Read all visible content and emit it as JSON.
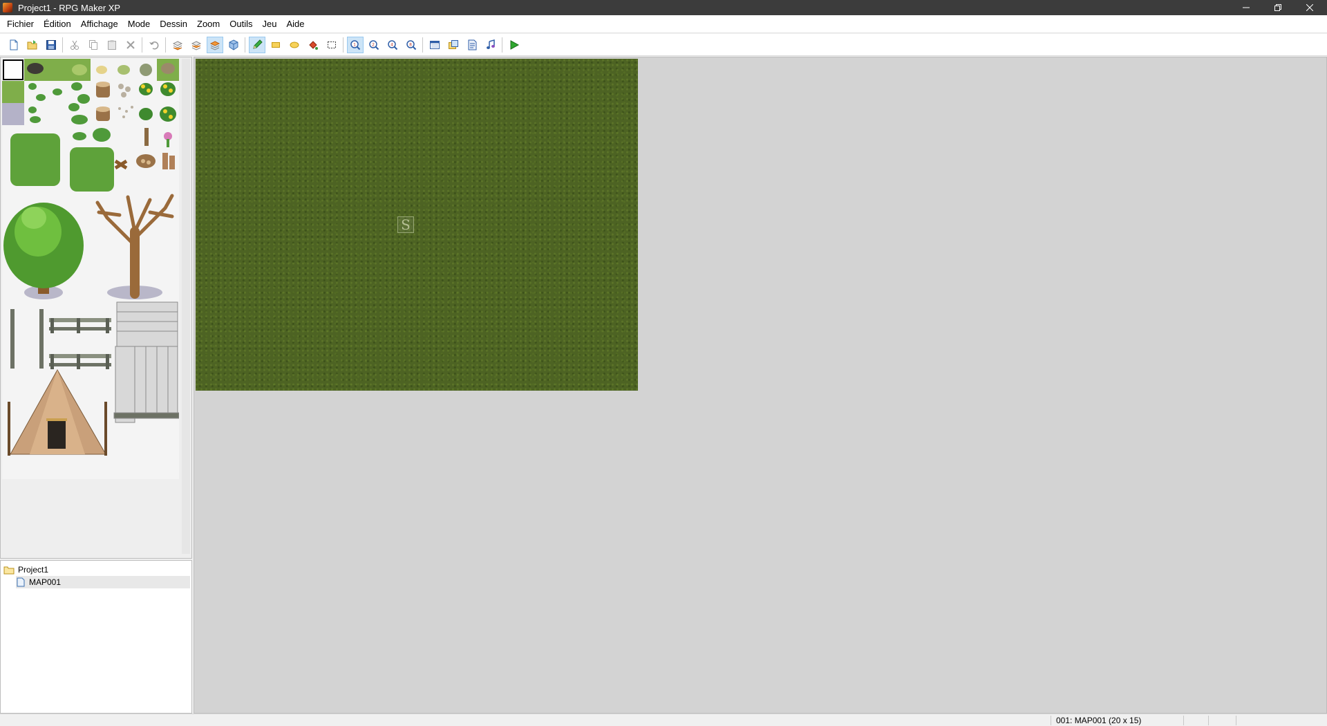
{
  "window": {
    "title": "Project1 - RPG Maker XP"
  },
  "menu": [
    "Fichier",
    "Édition",
    "Affichage",
    "Mode",
    "Dessin",
    "Zoom",
    "Outils",
    "Jeu",
    "Aide"
  ],
  "toolbar": {
    "groups": [
      [
        "new-project",
        "open-project",
        "save-project"
      ],
      [
        "cut",
        "copy",
        "paste",
        "delete"
      ],
      [
        "undo"
      ],
      [
        "layer-1",
        "layer-2",
        "layer-3",
        "events-layer"
      ],
      [
        "pencil",
        "rectangle",
        "ellipse",
        "flood-fill",
        "select"
      ],
      [
        "zoom-1-1",
        "zoom-1-2",
        "zoom-1-4",
        "zoom-1-8"
      ],
      [
        "database",
        "materialbase",
        "script-editor",
        "sound-test"
      ],
      [
        "playtest"
      ]
    ],
    "active": [
      "layer-3",
      "pencil",
      "zoom-1-1"
    ]
  },
  "map_tree": {
    "project": "Project1",
    "maps": [
      "MAP001"
    ]
  },
  "map": {
    "start_marker": "S"
  },
  "status": {
    "map_info": "001: MAP001 (20 x 15)"
  },
  "colors": {
    "grass": "#4d6323",
    "workspace": "#d3d3d3",
    "titlebar": "#3c3c3c"
  }
}
